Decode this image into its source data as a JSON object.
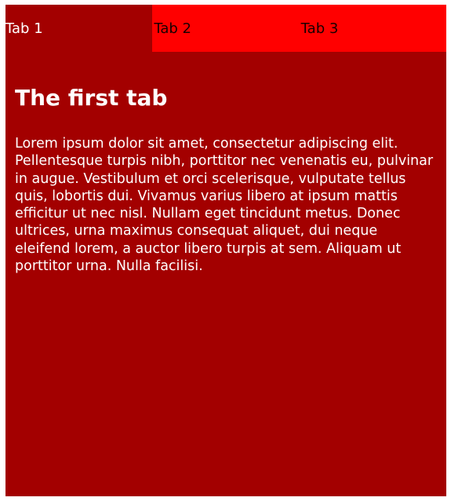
{
  "tabs": [
    {
      "label": "Tab 1",
      "active": true
    },
    {
      "label": "Tab 2",
      "active": false
    },
    {
      "label": "Tab 3",
      "active": false
    }
  ],
  "panel": {
    "title": "The first tab",
    "body": "Lorem ipsum dolor sit amet, consectetur adipiscing elit. Pellentesque turpis nibh, porttitor nec venenatis eu, pulvinar in augue. Vestibulum et orci scelerisque, vulputate tellus quis, lobortis dui. Vivamus varius libero at ipsum mattis efficitur ut nec nisl. Nullam eget tincidunt metus. Donec ultrices, urna maximus consequat aliquet, dui neque eleifend lorem, a auctor libero turpis at sem. Aliquam ut porttitor urna. Nulla facilisi."
  },
  "colors": {
    "active_tab": "#a30000",
    "inactive_tab": "#ff0000",
    "panel_background": "#a30000",
    "panel_text": "#ffffff"
  }
}
